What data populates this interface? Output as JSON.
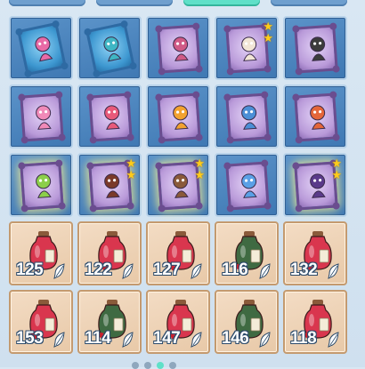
{
  "top_tabs": [
    {
      "label": "",
      "active": false
    },
    {
      "label": "",
      "active": false
    },
    {
      "label": "",
      "active": true
    },
    {
      "label": "",
      "active": false
    }
  ],
  "cards": [
    {
      "name": "pink-jellyfish-card",
      "style": "blue",
      "stars": 0,
      "accent": "#e86aa6"
    },
    {
      "name": "teal-dolphin-card",
      "style": "blue",
      "stars": 0,
      "accent": "#3fb6c4"
    },
    {
      "name": "fairy-girl-card",
      "style": "purple",
      "stars": 0,
      "accent": "#d05a86"
    },
    {
      "name": "white-fox-card",
      "style": "purple",
      "stars": 2,
      "accent": "#f2e6d6"
    },
    {
      "name": "panda-card",
      "style": "purple",
      "stars": 0,
      "accent": "#3c3c3c"
    },
    {
      "name": "pink-bird-card",
      "style": "purple",
      "stars": 0,
      "accent": "#f08ab8"
    },
    {
      "name": "pink-dragon-card",
      "style": "purple",
      "stars": 0,
      "accent": "#e85a7a"
    },
    {
      "name": "fire-lion-card",
      "style": "purple",
      "stars": 0,
      "accent": "#f2a230"
    },
    {
      "name": "blue-squirrel-card",
      "style": "purple",
      "stars": 0,
      "accent": "#4c8fd6"
    },
    {
      "name": "red-fox-card",
      "style": "purple",
      "stars": 0,
      "accent": "#e4663a"
    },
    {
      "name": "green-elf-card",
      "style": "purple",
      "stars": 0,
      "accent": "#8ccf4a",
      "rare": true
    },
    {
      "name": "dark-warrior-card",
      "style": "purple",
      "stars": 2,
      "accent": "#7a3a2a",
      "rare": true
    },
    {
      "name": "rider-card",
      "style": "purple",
      "stars": 2,
      "accent": "#8a5a3a",
      "rare": true
    },
    {
      "name": "snow-doll-card",
      "style": "purple",
      "stars": 0,
      "accent": "#5aa0e6"
    },
    {
      "name": "dark-mage-card",
      "style": "purple",
      "stars": 2,
      "accent": "#5a3a8a",
      "rare": true
    }
  ],
  "items": [
    {
      "name": "red-potion-jar",
      "color": "#d9364e",
      "quantity": "125"
    },
    {
      "name": "red-potion-jar",
      "color": "#d9364e",
      "quantity": "122"
    },
    {
      "name": "red-potion-jar",
      "color": "#d9364e",
      "quantity": "127"
    },
    {
      "name": "green-potion-jar",
      "color": "#3f6a42",
      "quantity": "116"
    },
    {
      "name": "red-potion-jar",
      "color": "#d9364e",
      "quantity": "132"
    },
    {
      "name": "red-potion-jar",
      "color": "#d9364e",
      "quantity": "153"
    },
    {
      "name": "green-potion-jar",
      "color": "#3f6a42",
      "quantity": "114"
    },
    {
      "name": "red-potion-jar",
      "color": "#d9364e",
      "quantity": "147"
    },
    {
      "name": "green-potion-jar",
      "color": "#3f6a42",
      "quantity": "146"
    },
    {
      "name": "red-potion-jar",
      "color": "#d9364e",
      "quantity": "118"
    }
  ],
  "pager": {
    "pages": 4,
    "active_index": 2
  }
}
